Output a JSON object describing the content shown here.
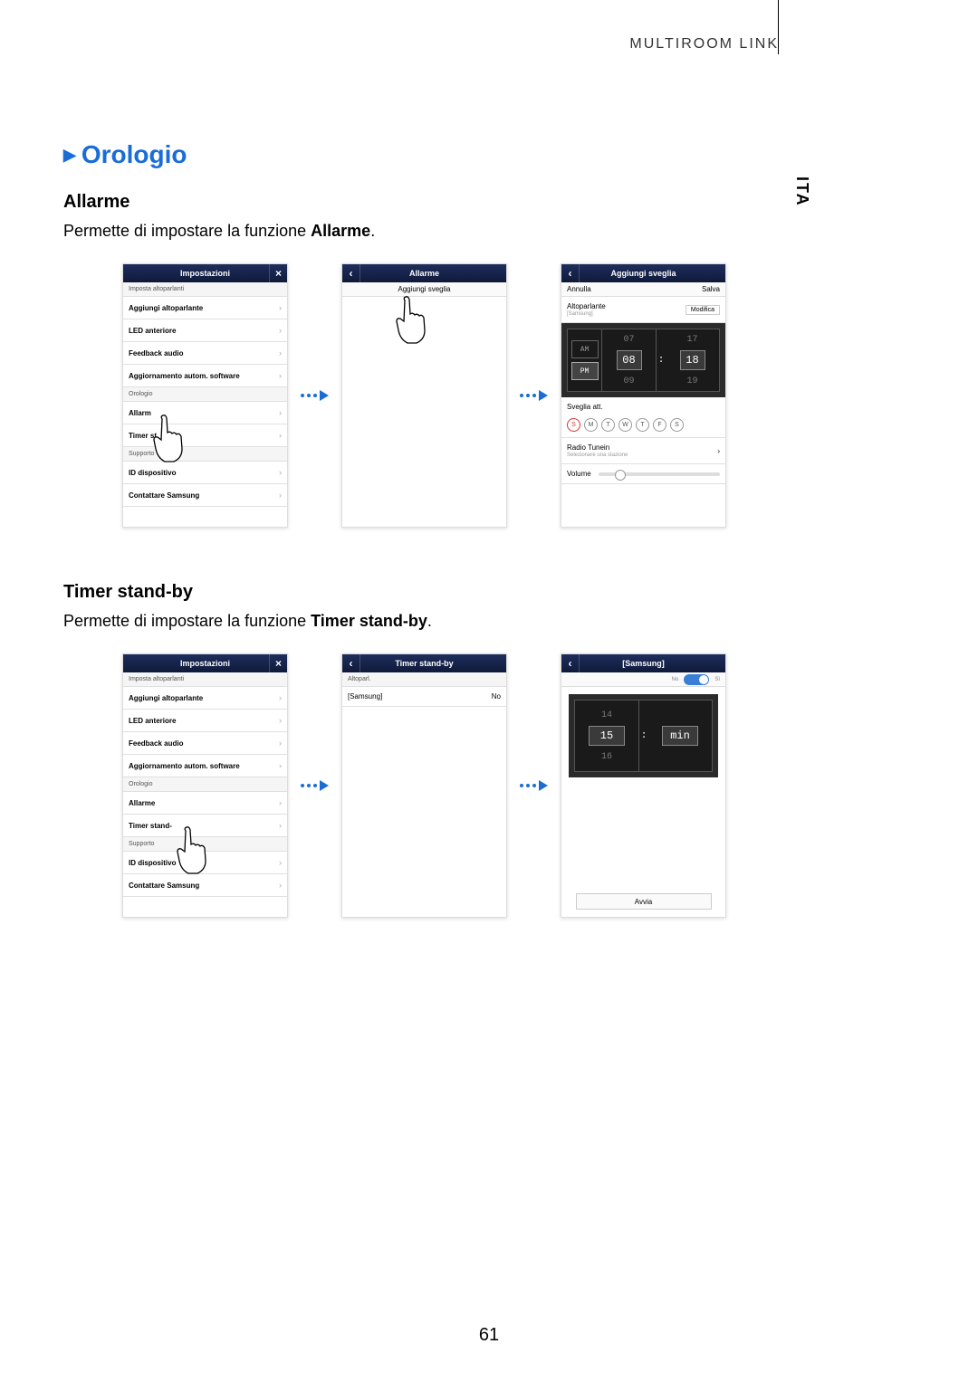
{
  "header": {
    "breadcrumb": "MULTIROOM LINK"
  },
  "side_tab": "ITA",
  "section_title": "Orologio",
  "page_number": "61",
  "alarm": {
    "heading": "Allarme",
    "body_prefix": "Permette di impostare la funzione ",
    "body_bold": "Allarme",
    "body_suffix": "."
  },
  "timer": {
    "heading": "Timer stand-by",
    "body_prefix": "Permette di impostare la funzione ",
    "body_bold": "Timer stand-by",
    "body_suffix": "."
  },
  "settings_screen": {
    "title": "Impostazioni",
    "sections": {
      "speakers": "Imposta altoparlanti",
      "clock": "Orologio",
      "support": "Supporto"
    },
    "items": {
      "add_speaker": "Aggiungi altoparlante",
      "led": "LED anteriore",
      "feedback": "Feedback audio",
      "sw_update": "Aggiornamento autom. software",
      "alarm": "Allarme",
      "timer": "Timer stand-by",
      "device_id": "ID dispositivo",
      "contact": "Contattare Samsung"
    },
    "alarm_truncated": "Allarm",
    "timer_small_truncated": "Timer st",
    "timer_large_truncated": "Timer stand-"
  },
  "alarm_screen": {
    "title": "Allarme",
    "add": "Aggiungi sveglia"
  },
  "add_alarm_screen": {
    "title": "Aggiungi sveglia",
    "cancel": "Annulla",
    "save": "Salva",
    "speaker_label": "Altoparlante",
    "speaker_value": "[Samsung]",
    "edit": "Modifica",
    "am": "AM",
    "pm": "PM",
    "hour_prev": "07",
    "hour": "08",
    "hour_next": "09",
    "min_prev": "17",
    "min": "18",
    "min_next": "19",
    "repeat_label": "Sveglia att.",
    "days": [
      "S",
      "M",
      "T",
      "W",
      "T",
      "F",
      "S"
    ],
    "radio_label": "Radio Tunein",
    "radio_sub": "Selezionare una stazione",
    "volume_label": "Volume"
  },
  "timer_list_screen": {
    "title": "Timer stand-by",
    "section": "Altoparl.",
    "item": "[Samsung]",
    "value": "No"
  },
  "timer_set_screen": {
    "title": "[Samsung]",
    "switch_no": "No",
    "switch_si": "Sì",
    "val_prev": "14",
    "val": "15",
    "val_next": "16",
    "unit": "min",
    "start": "Avvia"
  }
}
